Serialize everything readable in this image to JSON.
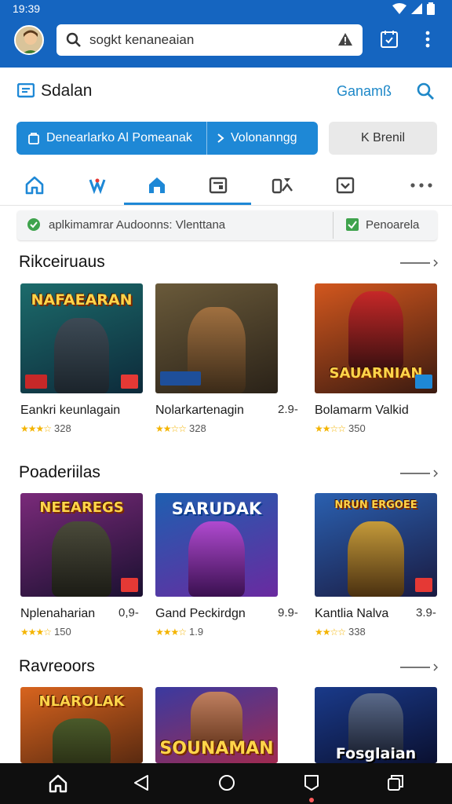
{
  "status": {
    "time": "19:39"
  },
  "appbar": {
    "search_text": "sogkt kenaneaian"
  },
  "header": {
    "brand": "Sdalan",
    "link": "Ganamß"
  },
  "buttons": {
    "primary": "Denearlarko Al Pomeanak",
    "secondary": "Volonanngg",
    "ghost": "K Brenil"
  },
  "filter": {
    "left": "aplkimamrar  Audoonns:  Vlenttana",
    "right": "Penoarela"
  },
  "sections": [
    {
      "title": "Rikceiruaus",
      "items": [
        {
          "art": "NAFAEARAN",
          "name": "Eankri keunlagain",
          "rating": "328",
          "price": ""
        },
        {
          "art": "",
          "name": "Nolarkartenagin",
          "rating": "328",
          "price": "2.9-"
        },
        {
          "art": "SAUARNIAN",
          "name": "Bolamarm Valkid",
          "rating": "350",
          "price": ""
        }
      ]
    },
    {
      "title": "Poaderiilas",
      "items": [
        {
          "art": "NEEAREGS",
          "name": "Nplenaharian",
          "rating": "150",
          "price": "0,9-"
        },
        {
          "art": "SARUDAK",
          "name": "Gand Peckirdgn",
          "rating": "1.9",
          "price": "9.9-"
        },
        {
          "art": "NRUN ERGOEE",
          "name": "Kantlia Nalva",
          "rating": "338",
          "price": "3.9-"
        }
      ]
    },
    {
      "title": "Ravreoors",
      "items": [
        {
          "art": "NLAROLAK",
          "name": "",
          "rating": "",
          "price": ""
        },
        {
          "art": "SOUNAMAN",
          "name": "",
          "rating": "",
          "price": ""
        },
        {
          "art": "Fosglaian",
          "name": "",
          "rating": "",
          "price": ""
        }
      ]
    }
  ],
  "colors": {
    "primary": "#1565c0",
    "accent": "#1e88d6",
    "star": "#f4b400"
  }
}
